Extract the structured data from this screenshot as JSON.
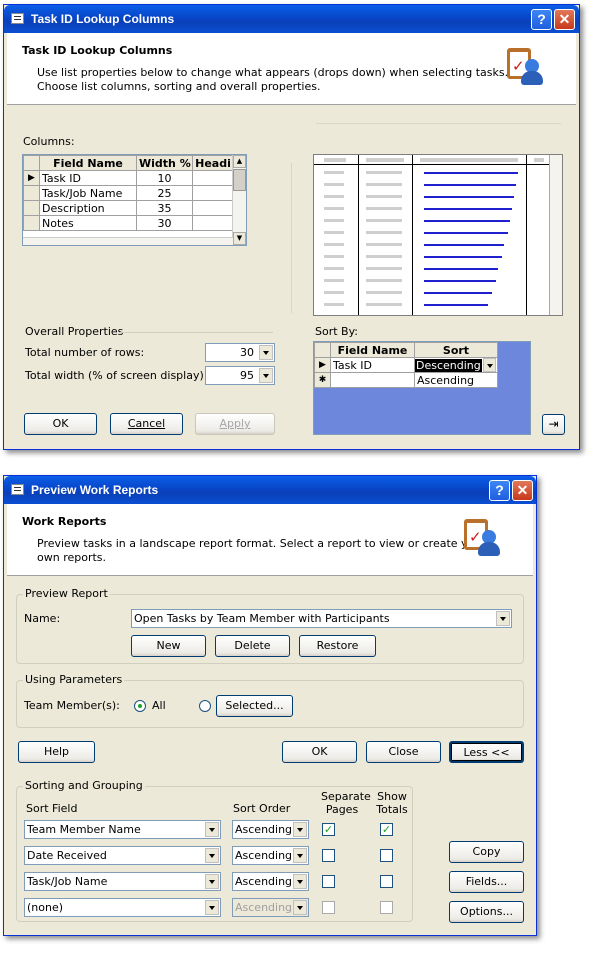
{
  "dialog1": {
    "title": "Task ID Lookup Columns",
    "header_title": "Task ID Lookup Columns",
    "header_desc_line1": "Use list properties below to change what appears (drops down) when selecting tasks.",
    "header_desc_line2": "Choose list columns, sorting and overall properties.",
    "columns_label": "Columns:",
    "columns_headers": [
      "Field Name",
      "Width %",
      "Headi"
    ],
    "columns_rows": [
      {
        "field": "Task ID",
        "width": "10"
      },
      {
        "field": "Task/Job Name",
        "width": "25"
      },
      {
        "field": "Description",
        "width": "35"
      },
      {
        "field": "Notes",
        "width": "30"
      }
    ],
    "overall_label": "Overall Properties",
    "rows_label": "Total number of rows:",
    "rows_value": "30",
    "width_label": "Total width (% of screen display):",
    "width_value": "95",
    "sortby_label": "Sort By:",
    "sort_headers": [
      "Field Name",
      "Sort"
    ],
    "sort_rows": [
      {
        "field": "Task ID",
        "sort": "Descending"
      }
    ],
    "sort_option": "Ascending",
    "ok": "OK",
    "cancel": "Cancel",
    "apply": "Apply"
  },
  "dialog2": {
    "title": "Preview Work Reports",
    "header_title": "Work Reports",
    "header_desc_line1": "Preview tasks in a landscape report format. Select a report to view or create your",
    "header_desc_line2": "own reports.",
    "preview_group": "Preview Report",
    "name_label": "Name:",
    "name_value": "Open Tasks by Team Member with Participants",
    "new": "New",
    "delete": "Delete",
    "restore": "Restore",
    "params_group": "Using Parameters",
    "team_label": "Team Member(s):",
    "all": "All",
    "selected": "Selected...",
    "help": "Help",
    "ok": "OK",
    "close": "Close",
    "less": "Less <<",
    "sorting_group": "Sorting and Grouping",
    "sort_field_header": "Sort Field",
    "sort_order_header": "Sort Order",
    "separate_header_1": "Separate",
    "separate_header_2": "Pages",
    "show_header_1": "Show",
    "show_header_2": "Totals",
    "sort_rows": [
      {
        "field": "Team Member Name",
        "order": "Ascending",
        "separate": true,
        "totals": true
      },
      {
        "field": "Date Received",
        "order": "Ascending",
        "separate": false,
        "totals": false
      },
      {
        "field": "Task/Job Name",
        "order": "Ascending",
        "separate": false,
        "totals": false
      },
      {
        "field": "(none)",
        "order": "Ascending",
        "separate": false,
        "totals": false
      }
    ],
    "copy": "Copy",
    "fields": "Fields...",
    "options": "Options..."
  }
}
